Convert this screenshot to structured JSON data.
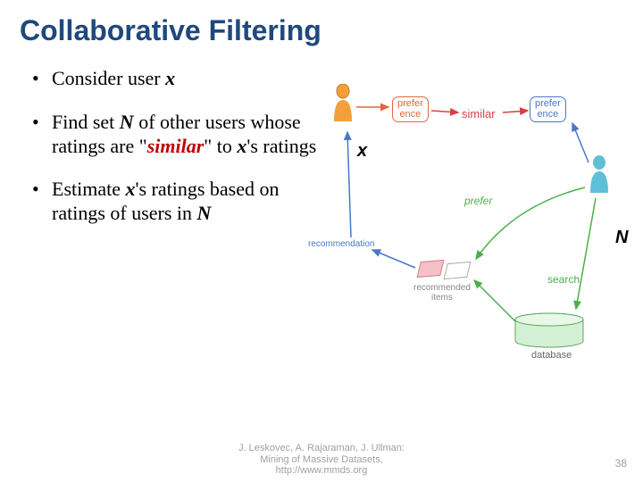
{
  "title": "Collaborative Filtering",
  "bullet1": {
    "lead": "Consider user ",
    "var": "x"
  },
  "bullet2": {
    "p1": "Find set ",
    "N": "N",
    "p2": " of other users whose ratings are \"",
    "similar": "similar",
    "p3": "\" to ",
    "x": "x",
    "p4": "'s ratings"
  },
  "bullet3": {
    "p1": "Estimate ",
    "x": "x",
    "p2": "'s ratings based on ratings of users in ",
    "N": "N"
  },
  "diagram": {
    "x_label": "x",
    "N_label": "N",
    "preference1": "prefer\nence",
    "preference2": "prefer\nence",
    "similar": "similar",
    "prefer_text": "prefer",
    "search": "search",
    "recommendation": "recommendation",
    "recommended_items": "recommended\nitems",
    "database": "database"
  },
  "footer": {
    "line1": "J. Leskovec, A. Rajaraman, J. Ullman:",
    "line2": "Mining of Massive Datasets,",
    "line3": "http://www.mmds.org"
  },
  "page_number": "38"
}
